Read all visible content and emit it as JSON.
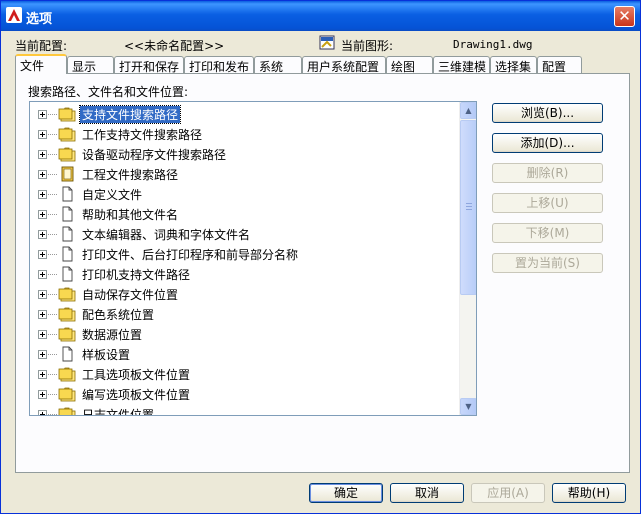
{
  "window": {
    "title": "选项",
    "close_glyph": "✕"
  },
  "header": {
    "profile_label": "当前配置:",
    "profile_value": "<<未命名配置>>",
    "drawing_label": "当前图形:",
    "drawing_value": "Drawing1.dwg"
  },
  "tabs": [
    "文件",
    "显示",
    "打开和保存",
    "打印和发布",
    "系统",
    "用户系统配置",
    "绘图",
    "三维建模",
    "选择集",
    "配置"
  ],
  "active_tab": "文件",
  "tree": {
    "caption": "搜索路径、文件名和文件位置:",
    "items": [
      {
        "label": "支持文件搜索路径",
        "icon": "folder-multi-icon",
        "selected": true
      },
      {
        "label": "工作支持文件搜索路径",
        "icon": "folder-multi-icon"
      },
      {
        "label": "设备驱动程序文件搜索路径",
        "icon": "folder-multi-icon"
      },
      {
        "label": "工程文件搜索路径",
        "icon": "project-book-icon"
      },
      {
        "label": "自定义文件",
        "icon": "document-icon"
      },
      {
        "label": "帮助和其他文件名",
        "icon": "document-icon"
      },
      {
        "label": "文本编辑器、词典和字体文件名",
        "icon": "document-icon"
      },
      {
        "label": "打印文件、后台打印程序和前导部分名称",
        "icon": "document-icon"
      },
      {
        "label": "打印机支持文件路径",
        "icon": "document-icon"
      },
      {
        "label": "自动保存文件位置",
        "icon": "folder-multi-icon"
      },
      {
        "label": "配色系统位置",
        "icon": "folder-multi-icon"
      },
      {
        "label": "数据源位置",
        "icon": "folder-multi-icon"
      },
      {
        "label": "样板设置",
        "icon": "document-icon"
      },
      {
        "label": "工具选项板文件位置",
        "icon": "folder-multi-icon"
      },
      {
        "label": "编写选项板文件位置",
        "icon": "folder-multi-icon"
      },
      {
        "label": "日志文件位置",
        "icon": "folder-multi-icon"
      }
    ]
  },
  "side_buttons": {
    "browse": "浏览(B)...",
    "add": "添加(D)...",
    "remove": "删除(R)",
    "move_up": "上移(U)",
    "move_down": "下移(M)",
    "set_current": "置为当前(S)"
  },
  "footer": {
    "ok": "确定",
    "cancel": "取消",
    "apply": "应用(A)",
    "help": "帮助(H)"
  }
}
